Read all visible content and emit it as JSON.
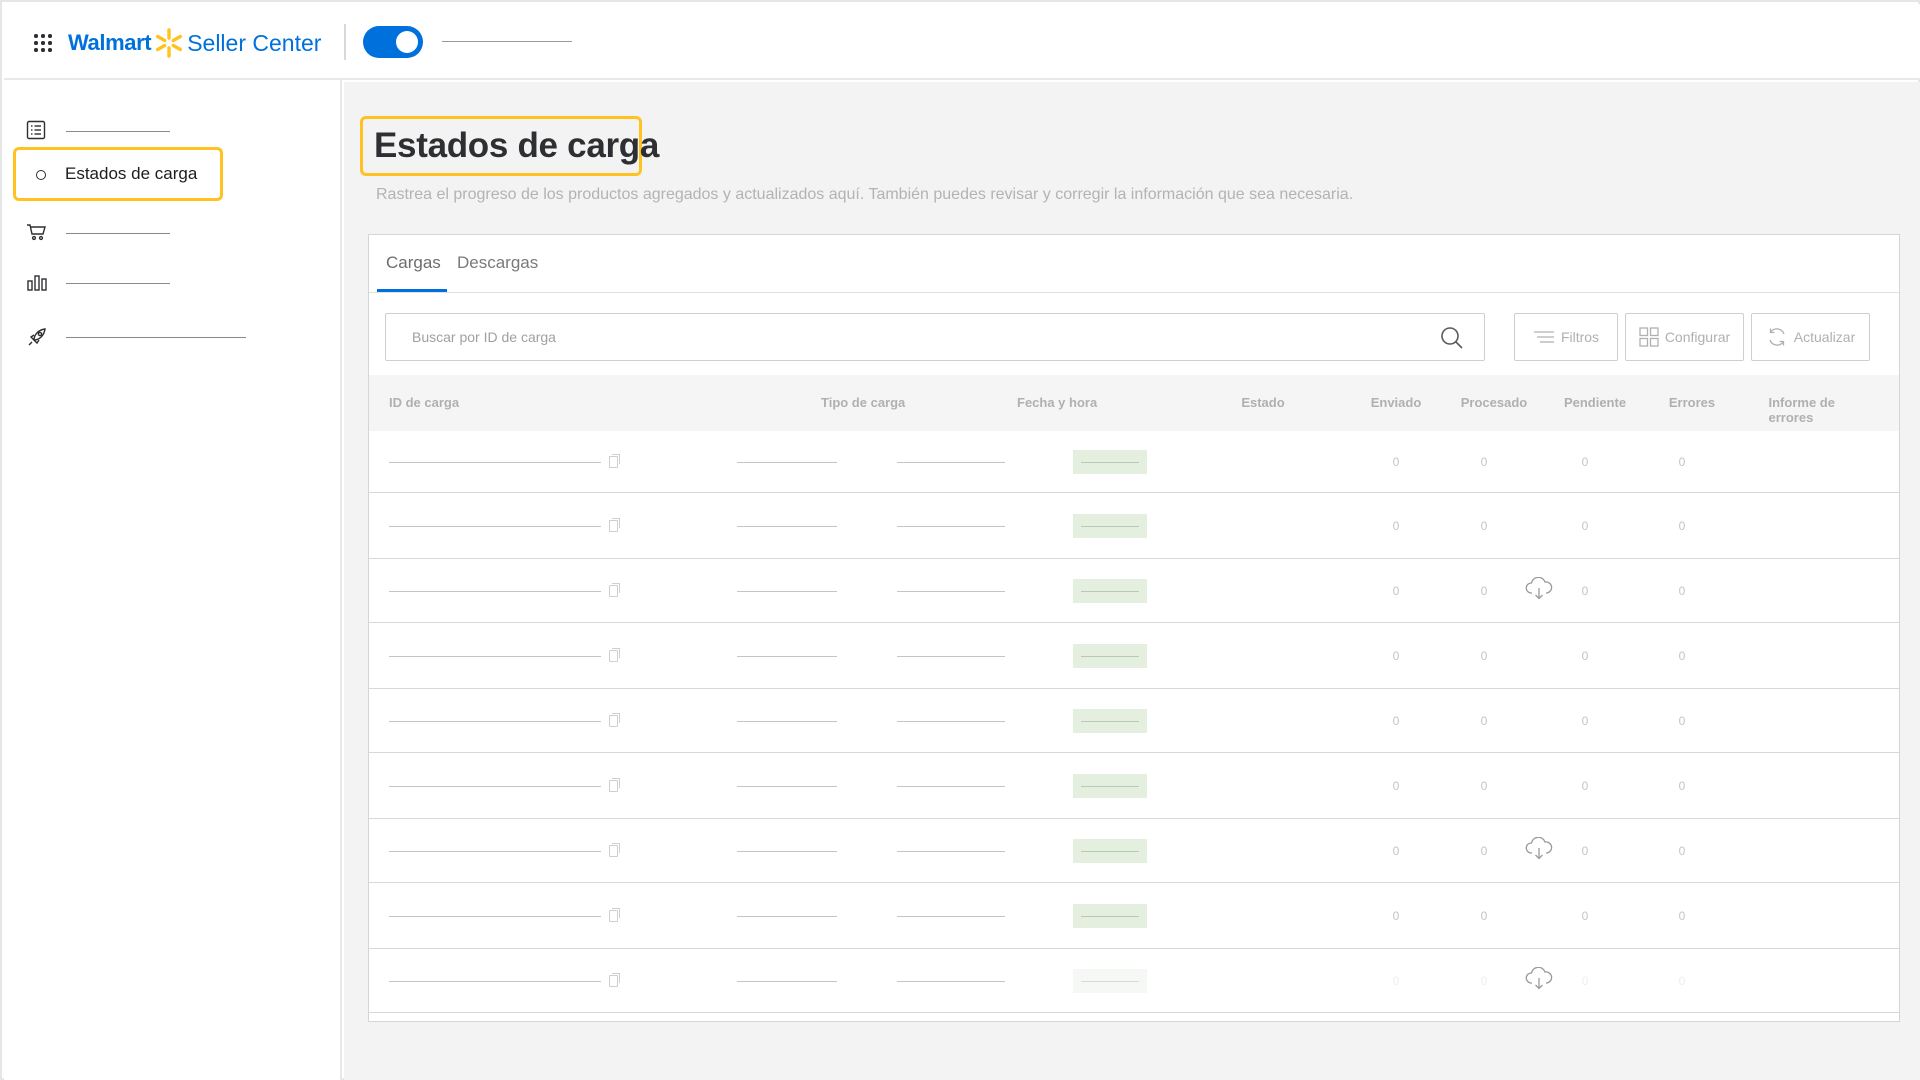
{
  "header": {
    "brand_name": "Walmart",
    "product_name": "Seller Center",
    "apps_icon": "grid-dots-icon",
    "toggle_on": true,
    "brand_color": "#0071dc",
    "spark_color": "#ffc220"
  },
  "sidebar": {
    "items": [
      {
        "icon": "list-icon",
        "label": ""
      },
      {
        "icon": "circle-icon",
        "label": "Estados de carga",
        "active": true
      },
      {
        "icon": "cart-icon",
        "label": ""
      },
      {
        "icon": "bar-chart-icon",
        "label": ""
      },
      {
        "icon": "rocket-icon",
        "label": ""
      }
    ],
    "highlight_color": "#ffc220"
  },
  "page": {
    "title": "Estados de carga",
    "subtitle": "Rastrea el progreso de los productos agregados y actualizados aquí. También puedes revisar y corregir la información que sea necesaria."
  },
  "tabs": [
    {
      "label": "Cargas",
      "active": true
    },
    {
      "label": "Descargas",
      "active": false
    }
  ],
  "toolbar": {
    "search_placeholder": "Buscar por ID de carga",
    "filters_label": "Filtros",
    "configure_label": "Configurar",
    "refresh_label": "Actualizar"
  },
  "table": {
    "columns": [
      "ID de carga",
      "Tipo de carga",
      "Fecha y hora",
      "Estado",
      "Enviado",
      "Procesado",
      "Pendiente",
      "Errores",
      "Informe de errores"
    ],
    "rows": [
      {
        "enviado": "0",
        "procesado": "0",
        "pendiente": "0",
        "errores": "0",
        "report": false,
        "faint": false
      },
      {
        "enviado": "0",
        "procesado": "0",
        "pendiente": "0",
        "errores": "0",
        "report": false,
        "faint": false
      },
      {
        "enviado": "0",
        "procesado": "0",
        "pendiente": "0",
        "errores": "0",
        "report": true,
        "faint": false
      },
      {
        "enviado": "0",
        "procesado": "0",
        "pendiente": "0",
        "errores": "0",
        "report": false,
        "faint": false
      },
      {
        "enviado": "0",
        "procesado": "0",
        "pendiente": "0",
        "errores": "0",
        "report": false,
        "faint": false
      },
      {
        "enviado": "0",
        "procesado": "0",
        "pendiente": "0",
        "errores": "0",
        "report": false,
        "faint": false
      },
      {
        "enviado": "0",
        "procesado": "0",
        "pendiente": "0",
        "errores": "0",
        "report": true,
        "faint": false
      },
      {
        "enviado": "0",
        "procesado": "0",
        "pendiente": "0",
        "errores": "0",
        "report": false,
        "faint": false
      },
      {
        "enviado": "0",
        "procesado": "0",
        "pendiente": "0",
        "errores": "0",
        "report": true,
        "faint": true
      }
    ]
  }
}
